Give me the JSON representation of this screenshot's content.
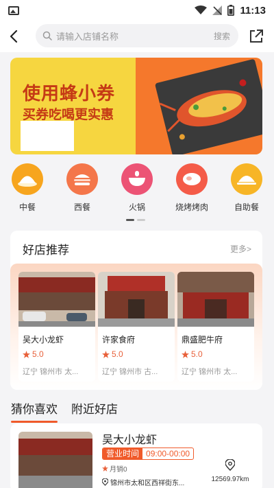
{
  "status_bar": {
    "time": "11:13"
  },
  "header": {
    "search_placeholder": "请输入店铺名称",
    "search_button": "搜索"
  },
  "banner": {
    "line1": "使用蜂小券",
    "line2": "买券吃喝更实惠"
  },
  "categories": [
    {
      "label": "中餐",
      "icon": "bun-icon",
      "color": "#f7a51e"
    },
    {
      "label": "西餐",
      "icon": "burger-icon",
      "color": "#f4764a"
    },
    {
      "label": "火锅",
      "icon": "hotpot-icon",
      "color": "#ec5375"
    },
    {
      "label": "烧烤烤肉",
      "icon": "meat-icon",
      "color": "#f45b48"
    },
    {
      "label": "自助餐",
      "icon": "buffet-icon",
      "color": "#f7b526"
    }
  ],
  "recommend": {
    "title": "好店推荐",
    "more": "更多>",
    "shops": [
      {
        "name": "吴大小龙虾",
        "rating": "5.0",
        "address": "辽宁 锦州市 太..."
      },
      {
        "name": "许家食府",
        "rating": "5.0",
        "address": "辽宁 锦州市 古..."
      },
      {
        "name": "鼎盛肥牛府",
        "rating": "5.0",
        "address": "辽宁 锦州市 太..."
      }
    ]
  },
  "tabs": [
    {
      "label": "猜你喜欢",
      "active": true
    },
    {
      "label": "附近好店",
      "active": false
    }
  ],
  "listing": {
    "name": "吴大小龙虾",
    "hours_label": "营业时间",
    "hours_value": "09:00-00:00",
    "sales": "月销0",
    "location": "锦州市太和区西祥街东...",
    "distance": "12569.97km"
  },
  "colors": {
    "accent": "#f05a2a",
    "star": "#e8603a"
  }
}
